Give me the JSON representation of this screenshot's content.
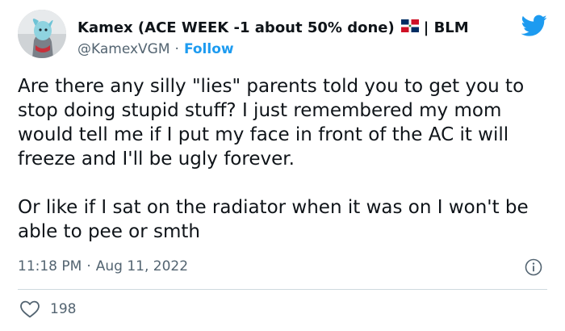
{
  "author": {
    "display_name": "Kamex (ACE WEEK -1 about 50% done)",
    "flag_icon": "dominican-republic-flag",
    "name_suffix": "| BLM",
    "handle": "@KamexVGM",
    "separator": "·",
    "follow_label": "Follow"
  },
  "tweet": {
    "text": "Are there any silly \"lies\" parents told you to get you to stop doing stupid stuff? I just remembered my mom would tell me if I put my face in front of the AC it will freeze and I'll be ugly forever.\n\nOr like if I sat on the radiator when it was on I won't be able to pee or smth",
    "time": "11:18 PM",
    "separator": "·",
    "date": "Aug 11, 2022"
  },
  "engagement": {
    "likes": "198"
  },
  "colors": {
    "accent": "#1d9bf0",
    "text": "#0f1419",
    "muted": "#536471",
    "divider": "#cfd9de"
  },
  "icons": [
    "twitter-bird-icon",
    "info-icon",
    "heart-icon"
  ]
}
